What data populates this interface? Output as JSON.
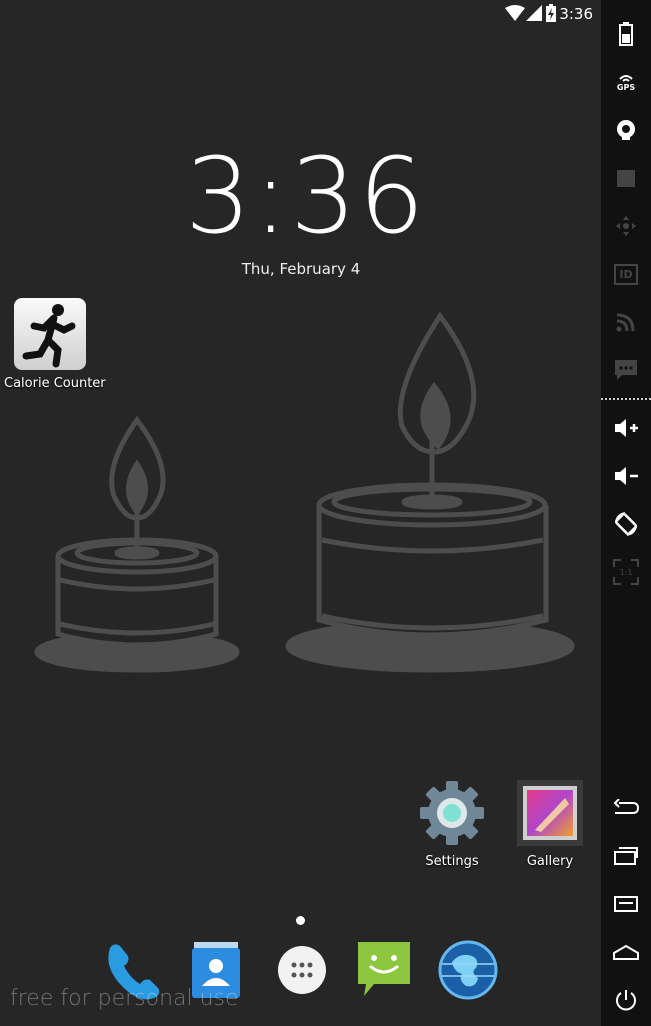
{
  "status_bar": {
    "time": "3:36",
    "icons": [
      "wifi-icon",
      "signal-icon",
      "battery-charging-icon"
    ]
  },
  "lock_clock": {
    "time": "3:36",
    "date": "Thu, February 4"
  },
  "desktop_apps": [
    {
      "label": "Calorie Counter",
      "icon": "runner-icon"
    },
    {
      "label": "Settings",
      "icon": "gear-icon"
    },
    {
      "label": "Gallery",
      "icon": "gallery-icon"
    }
  ],
  "dock": [
    "phone-icon",
    "contacts-icon",
    "app-drawer-icon",
    "messaging-icon",
    "browser-icon"
  ],
  "watermark": "free for personal use",
  "emulator_sidebar": {
    "buttons": [
      "battery-icon",
      "gps-icon",
      "camera-icon",
      "media-icon",
      "dpad-icon",
      "id-icon",
      "cast-icon",
      "sms-icon",
      "volume-up-icon",
      "volume-down-icon",
      "rotate-icon",
      "scale-icon",
      "back-icon",
      "recent-apps-icon",
      "menu-icon",
      "home-icon",
      "power-icon"
    ],
    "gps_label": "GPS",
    "id_label": "ID",
    "scale_label": "1:1"
  },
  "colors": {
    "background": "#262626",
    "candle": "#4a4a4a",
    "sidebar": "#111111"
  }
}
